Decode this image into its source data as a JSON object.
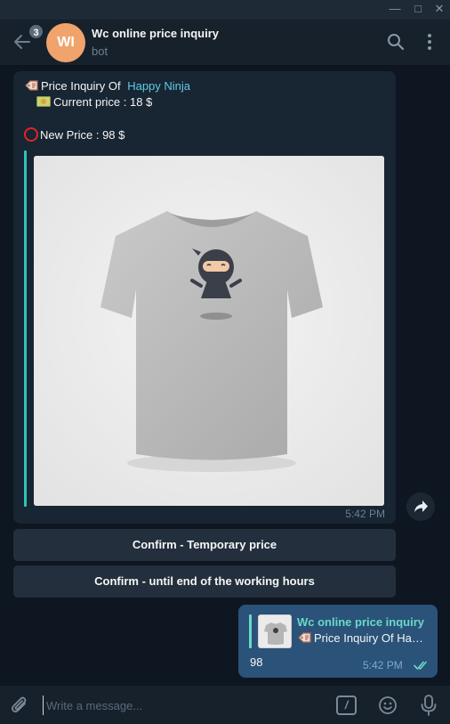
{
  "chat": {
    "title": "Wc online price inquiry",
    "subtitle": "bot",
    "avatar_initials": "WI",
    "unread_count": "3"
  },
  "incoming": {
    "line1_prefix": "Price Inquiry Of ",
    "product_name": "Happy Ninja",
    "current_price": "Current price : 18 $",
    "new_price": "New Price : 98 $",
    "time": "5:42 PM"
  },
  "keyboard": {
    "buttons": [
      "Confirm - Temporary price",
      "Confirm - until end of the working hours"
    ]
  },
  "outgoing": {
    "reply_name": "Wc online price inquiry",
    "reply_text": "Price Inquiry Of  Happy Ninja",
    "text": "98",
    "time": "5:42 PM"
  },
  "composer": {
    "placeholder": "Write a message..."
  },
  "colors": {
    "accent_link": "#61c9e5",
    "reply_accent": "#69d9c7",
    "outgoing_bubble": "#2b5278",
    "incoming_bubble": "#182533",
    "avatar": "#f0a36b"
  }
}
